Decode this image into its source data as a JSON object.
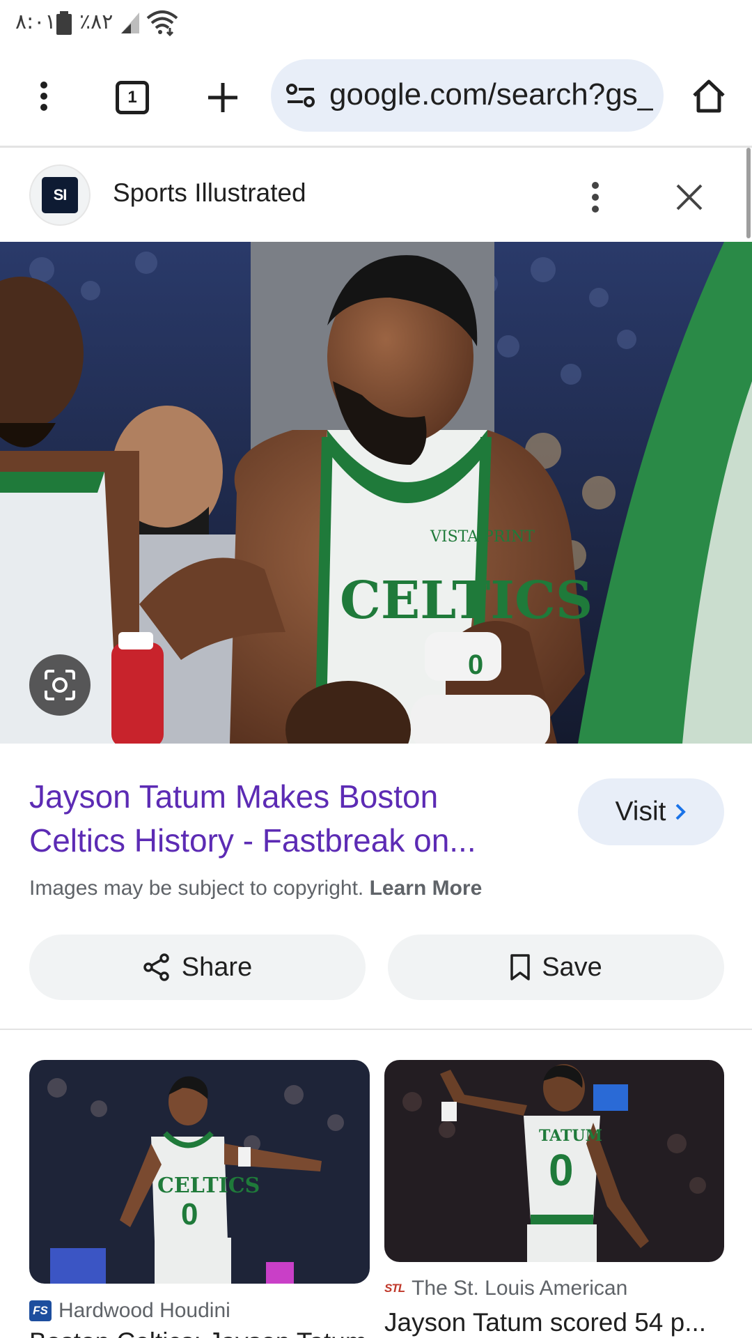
{
  "status_bar": {
    "time": "۸:۰۱",
    "battery": "٪۸۲"
  },
  "toolbar": {
    "tab_count": "1",
    "url": "google.com/search?gs_ssp"
  },
  "source": {
    "logo_text": "SI",
    "name": "Sports Illustrated"
  },
  "result": {
    "title": "Jayson Tatum Makes Boston Celtics History - Fastbreak on...",
    "visit_label": "Visit",
    "copyright_text": "Images may be subject to copyright.",
    "learn_more": "Learn More",
    "share_label": "Share",
    "save_label": "Save"
  },
  "hero": {
    "jersey_text": "CELTICS",
    "sponsor_text": "VISTA PRINT",
    "number": "0"
  },
  "related": [
    {
      "source_logo": "FS",
      "source": "Hardwood Houdini",
      "title": "Boston Celtics: Jayson Tatum",
      "jersey_text": "CELTICS",
      "number": "0"
    },
    {
      "source_logo": "STL",
      "source": "The St. Louis American",
      "title": "Jayson Tatum scored 54 p...",
      "jersey_text": "TATUM",
      "number": "0"
    }
  ],
  "colors": {
    "title_purple": "#5c2bb4",
    "chip_bg": "#e8eef8",
    "button_bg": "#f1f3f4",
    "celtics_green": "#1f7a3a"
  }
}
